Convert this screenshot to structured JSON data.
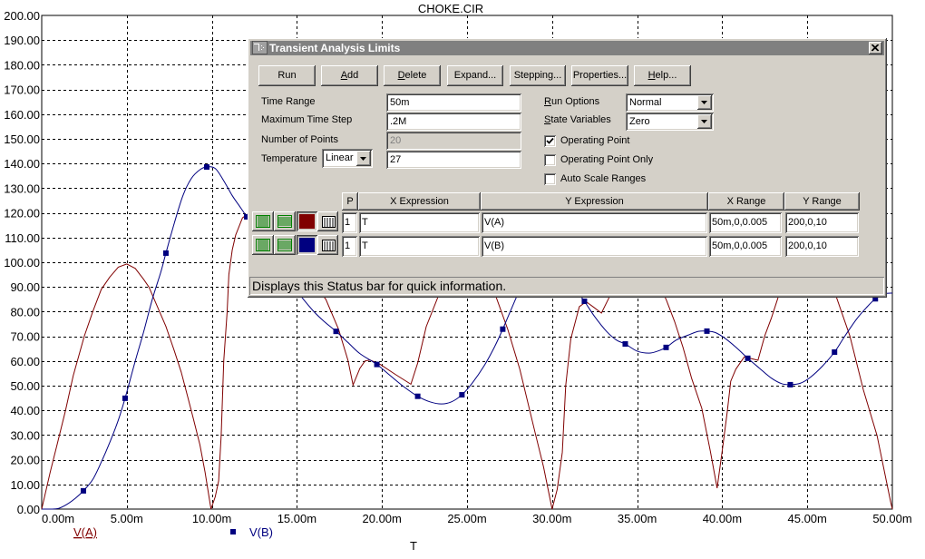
{
  "chart_data": {
    "type": "line",
    "title": "CHOKE.CIR",
    "xlabel": "T",
    "ylabel": "",
    "x_unit": "ms",
    "xlim": [
      0,
      50
    ],
    "ylim": [
      0,
      200
    ],
    "grid": true,
    "legend_placement": "bottom-left",
    "x_ticks": [
      0,
      5,
      10,
      15,
      20,
      25,
      30,
      35,
      40,
      45,
      50
    ],
    "x_tick_labels": [
      "0.00m",
      "5.00m",
      "10.00m",
      "15.00m",
      "20.00m",
      "25.00m",
      "30.00m",
      "35.00m",
      "40.00m",
      "45.00m",
      "50.00m"
    ],
    "y_ticks": [
      0,
      10,
      20,
      30,
      40,
      50,
      60,
      70,
      80,
      90,
      100,
      110,
      120,
      130,
      140,
      150,
      160,
      170,
      180,
      190,
      200
    ],
    "y_tick_labels": [
      "0.00",
      "10.00",
      "20.00",
      "30.00",
      "40.00",
      "50.00",
      "60.00",
      "70.00",
      "80.00",
      "90.00",
      "100.00",
      "110.00",
      "120.00",
      "130.00",
      "140.00",
      "150.00",
      "160.00",
      "170.00",
      "180.00",
      "190.00",
      "200.00"
    ],
    "legend": [
      {
        "name": "V(A)",
        "color": "#800000",
        "marker": "none"
      },
      {
        "name": "V(B)",
        "color": "#000080",
        "marker": "square"
      }
    ],
    "series": [
      {
        "name": "V(A)",
        "color": "#800000",
        "marker": "none",
        "points": [
          [
            0,
            0
          ],
          [
            0.5,
            15
          ],
          [
            0.9,
            26
          ],
          [
            1.4,
            40
          ],
          [
            1.85,
            54
          ],
          [
            2.5,
            70
          ],
          [
            3.0,
            80
          ],
          [
            3.5,
            89
          ],
          [
            4.0,
            94
          ],
          [
            4.5,
            98
          ],
          [
            5.0,
            99.3
          ],
          [
            5.5,
            97.5
          ],
          [
            6.0,
            93
          ],
          [
            6.3,
            90
          ],
          [
            6.8,
            82
          ],
          [
            7.3,
            74
          ],
          [
            7.8,
            64
          ],
          [
            8.2,
            55.5
          ],
          [
            8.6,
            45
          ],
          [
            8.9,
            37
          ],
          [
            9.3,
            26
          ],
          [
            9.6,
            15
          ],
          [
            9.95,
            0
          ],
          [
            10.2,
            5
          ],
          [
            10.4,
            11.4
          ],
          [
            10.55,
            30
          ],
          [
            10.7,
            60
          ],
          [
            10.9,
            80
          ],
          [
            11.0,
            95
          ],
          [
            11.2,
            105
          ],
          [
            11.4,
            111
          ],
          [
            11.8,
            118
          ],
          [
            12.1,
            119.5
          ],
          [
            12.6,
            119.5
          ],
          [
            13.3,
            116
          ],
          [
            14.2,
            108
          ],
          [
            15.2,
            98
          ],
          [
            16.0,
            91
          ],
          [
            16.7,
            85
          ],
          [
            17.45,
            72.8
          ],
          [
            18.0,
            60.3
          ],
          [
            18.3,
            50.3
          ],
          [
            18.7,
            57
          ],
          [
            19.0,
            60
          ],
          [
            19.3,
            60.4
          ],
          [
            19.9,
            58.6
          ],
          [
            20.8,
            54.5
          ],
          [
            21.7,
            50.6
          ],
          [
            22.1,
            59.2
          ],
          [
            22.6,
            73.9
          ],
          [
            23.3,
            86.1
          ],
          [
            24.0,
            96
          ],
          [
            25.0,
            100
          ],
          [
            26.0,
            95
          ],
          [
            26.7,
            86.1
          ],
          [
            27.4,
            72.7
          ],
          [
            28.1,
            56.7
          ],
          [
            29.0,
            31
          ],
          [
            29.5,
            17
          ],
          [
            30.0,
            0
          ],
          [
            30.3,
            8
          ],
          [
            30.6,
            23
          ],
          [
            30.8,
            50
          ],
          [
            31.1,
            69
          ],
          [
            31.6,
            82
          ],
          [
            32.0,
            84
          ],
          [
            32.4,
            82
          ],
          [
            32.9,
            79.4
          ],
          [
            33.3,
            85
          ],
          [
            34.0,
            95
          ],
          [
            35.0,
            99
          ],
          [
            36.0,
            94
          ],
          [
            36.7,
            85
          ],
          [
            37.2,
            76
          ],
          [
            37.7,
            65.4
          ],
          [
            38.2,
            53
          ],
          [
            38.8,
            40.8
          ],
          [
            39.3,
            23.5
          ],
          [
            39.7,
            8.5
          ],
          [
            40.0,
            23.6
          ],
          [
            40.3,
            39.7
          ],
          [
            40.5,
            51.8
          ],
          [
            40.8,
            56.7
          ],
          [
            41.3,
            61.7
          ],
          [
            41.7,
            61
          ],
          [
            42.1,
            60.3
          ],
          [
            42.5,
            70.2
          ],
          [
            42.9,
            77.6
          ],
          [
            43.3,
            86.1
          ],
          [
            44.0,
            96
          ],
          [
            45.0,
            100
          ],
          [
            46.0,
            95
          ],
          [
            46.7,
            86.1
          ],
          [
            47.5,
            70.2
          ],
          [
            48.3,
            48.2
          ],
          [
            49.1,
            29.8
          ],
          [
            49.9,
            2.9
          ],
          [
            50,
            0
          ]
        ]
      },
      {
        "name": "V(B)",
        "color": "#000080",
        "marker": "square",
        "points": [
          [
            0,
            0
          ],
          [
            0.5,
            0
          ],
          [
            1.0,
            0.3
          ],
          [
            1.5,
            2
          ],
          [
            2.0,
            4.5
          ],
          [
            2.45,
            7.4
          ],
          [
            3.0,
            12
          ],
          [
            3.5,
            19
          ],
          [
            4.0,
            27
          ],
          [
            4.5,
            36
          ],
          [
            4.9,
            44.9
          ],
          [
            5.5,
            60
          ],
          [
            6.0,
            72
          ],
          [
            6.5,
            85
          ],
          [
            7.0,
            96
          ],
          [
            7.3,
            103.7
          ],
          [
            7.8,
            116
          ],
          [
            8.3,
            127
          ],
          [
            8.8,
            134
          ],
          [
            9.3,
            137.5
          ],
          [
            9.7,
            138.6
          ],
          [
            10.2,
            138
          ],
          [
            10.7,
            133
          ],
          [
            11.2,
            127
          ],
          [
            11.6,
            123
          ],
          [
            12.05,
            118.4
          ],
          [
            12.6,
            112
          ],
          [
            13.3,
            104
          ],
          [
            14.0,
            97
          ],
          [
            14.7,
            91
          ],
          [
            15.3,
            85.7
          ],
          [
            16.0,
            80
          ],
          [
            16.6,
            76
          ],
          [
            17.3,
            72
          ],
          [
            18.0,
            67.5
          ],
          [
            18.7,
            63
          ],
          [
            19.7,
            58.6
          ],
          [
            20.5,
            54
          ],
          [
            21.3,
            49.5
          ],
          [
            22.1,
            45.7
          ],
          [
            22.8,
            43.5
          ],
          [
            23.5,
            42.6
          ],
          [
            24.1,
            43.5
          ],
          [
            24.7,
            46.3
          ],
          [
            25.3,
            51
          ],
          [
            26.0,
            58
          ],
          [
            26.6,
            65.5
          ],
          [
            27.1,
            72.9
          ],
          [
            27.6,
            81
          ],
          [
            28.1,
            88.6
          ],
          [
            28.8,
            96
          ],
          [
            29.5,
            100
          ],
          [
            30.2,
            100
          ],
          [
            30.9,
            95
          ],
          [
            31.4,
            89
          ],
          [
            31.9,
            84.2
          ],
          [
            32.5,
            78
          ],
          [
            33.2,
            72
          ],
          [
            33.8,
            68.4
          ],
          [
            34.3,
            66.9
          ],
          [
            35.0,
            64
          ],
          [
            35.7,
            63.2
          ],
          [
            36.2,
            64
          ],
          [
            36.7,
            65.5
          ],
          [
            37.3,
            68.5
          ],
          [
            38.0,
            70.5
          ],
          [
            38.6,
            72
          ],
          [
            39.1,
            72.1
          ],
          [
            39.6,
            71.5
          ],
          [
            40.2,
            69
          ],
          [
            40.9,
            65
          ],
          [
            41.5,
            61.1
          ],
          [
            42.2,
            57
          ],
          [
            42.9,
            53
          ],
          [
            43.5,
            50.8
          ],
          [
            44.0,
            50.4
          ],
          [
            44.6,
            51
          ],
          [
            45.2,
            53.5
          ],
          [
            45.9,
            58
          ],
          [
            46.6,
            63.6
          ],
          [
            47.2,
            70
          ],
          [
            47.9,
            77
          ],
          [
            48.5,
            81.8
          ],
          [
            49.0,
            85.2
          ],
          [
            49.5,
            87.2
          ],
          [
            50,
            87.5
          ]
        ],
        "marker_points": [
          [
            2.45,
            7.4
          ],
          [
            4.9,
            44.9
          ],
          [
            7.3,
            103.7
          ],
          [
            9.7,
            138.6
          ],
          [
            12.05,
            118.4
          ],
          [
            17.3,
            72
          ],
          [
            19.7,
            58.6
          ],
          [
            22.1,
            45.7
          ],
          [
            24.7,
            46.3
          ],
          [
            27.1,
            72.9
          ],
          [
            31.9,
            84.2
          ],
          [
            34.3,
            66.9
          ],
          [
            36.7,
            65.5
          ],
          [
            39.1,
            72.1
          ],
          [
            41.5,
            61.1
          ],
          [
            44.0,
            50.4
          ],
          [
            46.6,
            63.6
          ],
          [
            49.0,
            85.2
          ]
        ]
      }
    ]
  },
  "dialog": {
    "title": "Transient Analysis Limits",
    "icons": {
      "app": "app-icon",
      "close": "close-icon",
      "dropdown": "chevron-down-icon"
    },
    "buttons": [
      {
        "label": "Run",
        "accel": ""
      },
      {
        "label": "Add",
        "accel": "A"
      },
      {
        "label": "Delete",
        "accel": "D"
      },
      {
        "label": "Expand...",
        "accel": ""
      },
      {
        "label": "Stepping...",
        "accel": ""
      },
      {
        "label": "Properties...",
        "accel": ""
      },
      {
        "label": "Help...",
        "accel": "H"
      }
    ],
    "fields": {
      "time_range": {
        "label": "Time Range",
        "value": "50m"
      },
      "max_time_step": {
        "label": "Maximum Time Step",
        "value": ".2M"
      },
      "num_points": {
        "label": "Number of Points",
        "value": "20",
        "disabled": true
      },
      "temperature": {
        "label": "Temperature",
        "mode": "Linear",
        "value": "27"
      }
    },
    "run_options": {
      "label": "Run Options",
      "accel": "R",
      "value": "Normal"
    },
    "state_variables": {
      "label": "State Variables",
      "accel": "S",
      "value": "Zero"
    },
    "checkboxes": [
      {
        "label": "Operating Point",
        "checked": true
      },
      {
        "label": "Operating Point Only",
        "checked": false
      },
      {
        "label": "Auto Scale Ranges",
        "checked": false
      }
    ],
    "table": {
      "headers": [
        "P",
        "X Expression",
        "Y Expression",
        "X Range",
        "Y Range"
      ],
      "rows": [
        {
          "color": "#800000",
          "p": "1",
          "x_expr": "T",
          "y_expr": "V(A)",
          "x_range": "50m,0,0.005",
          "y_range": "200,0,10"
        },
        {
          "color": "#000080",
          "p": "1",
          "x_expr": "T",
          "y_expr": "V(B)",
          "x_range": "50m,0,0.005",
          "y_range": "200,0,10"
        }
      ]
    },
    "status": "Displays this Status bar for quick information."
  }
}
